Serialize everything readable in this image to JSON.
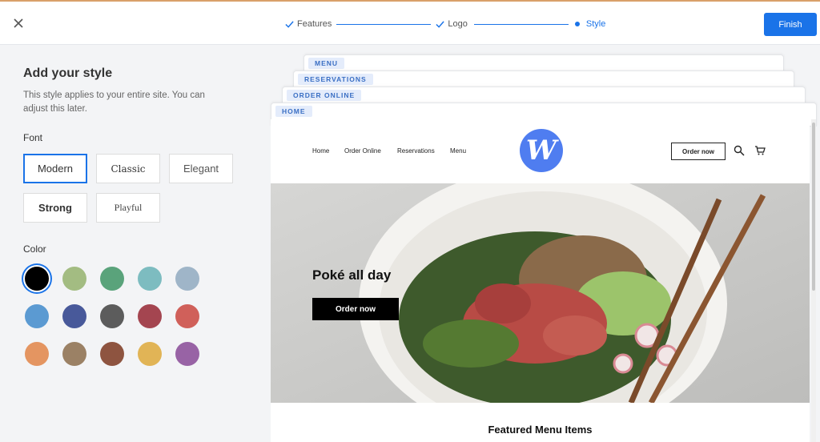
{
  "topbar": {
    "steps": [
      {
        "label": "Features",
        "state": "done"
      },
      {
        "label": "Logo",
        "state": "done"
      },
      {
        "label": "Style",
        "state": "active"
      }
    ],
    "finish_label": "Finish"
  },
  "panel": {
    "title": "Add your style",
    "description": "This style applies to your entire site. You can adjust this later.",
    "font_label": "Font",
    "fonts": [
      {
        "label": "Modern",
        "selected": true
      },
      {
        "label": "Classic",
        "selected": false
      },
      {
        "label": "Elegant",
        "selected": false
      },
      {
        "label": "Strong",
        "selected": false
      },
      {
        "label": "Playful",
        "selected": false
      }
    ],
    "color_label": "Color",
    "colors": [
      "#000000",
      "#a3bc82",
      "#5aa37b",
      "#7dbcc0",
      "#9fb5c8",
      "#5b9ad2",
      "#48599a",
      "#5c5c5c",
      "#a44550",
      "#d0605a",
      "#e49561",
      "#9b8165",
      "#8e5440",
      "#e1b456",
      "#9863a5"
    ],
    "selected_color": "#000000"
  },
  "preview": {
    "tabs": [
      "MENU",
      "RESERVATIONS",
      "ORDER ONLINE",
      "HOME"
    ],
    "nav_links": [
      "Home",
      "Order Online",
      "Reservations",
      "Menu"
    ],
    "logo_letter": "W",
    "nav_order_label": "Order now",
    "hero_title": "Poké all day",
    "hero_button": "Order now",
    "featured_title": "Featured Menu Items"
  }
}
